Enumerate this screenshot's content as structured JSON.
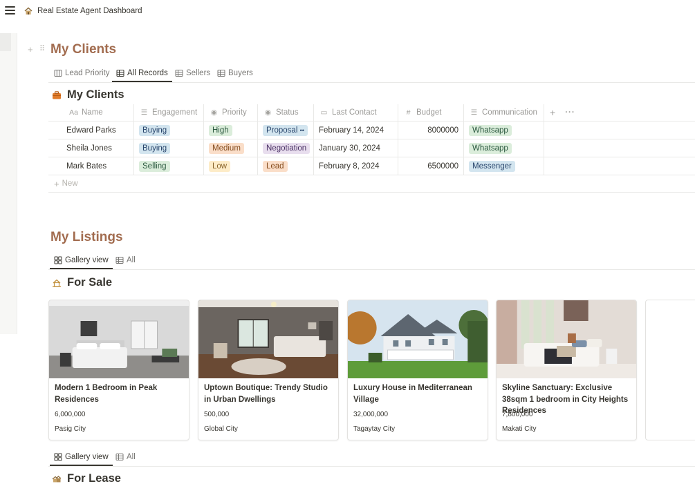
{
  "topbar": {
    "title": "Real Estate Agent Dashboard",
    "icon": "house-icon"
  },
  "clients": {
    "heading": "My Clients",
    "tabs": [
      "Lead Priority",
      "All Records",
      "Sellers",
      "Buyers"
    ],
    "active_tab": "All Records",
    "db_title": "My Clients",
    "columns": {
      "name": {
        "icon": "Aa",
        "label": "Name"
      },
      "engagement": {
        "icon": "list-icon",
        "label": "Engagement"
      },
      "priority": {
        "icon": "status-icon",
        "label": "Priority"
      },
      "status": {
        "icon": "status-icon",
        "label": "Status"
      },
      "last_contact": {
        "icon": "calendar-icon",
        "label": "Last Contact"
      },
      "budget": {
        "icon": "#",
        "label": "Budget"
      },
      "communication": {
        "icon": "list-icon",
        "label": "Communication"
      }
    },
    "add_column": "+",
    "more": "···",
    "rows": [
      {
        "name": "Edward Parks",
        "engagement": "Buying",
        "priority": "High",
        "status": "Proposal",
        "last_contact": "February 14, 2024",
        "budget": "8000000",
        "communication": "Whatsapp"
      },
      {
        "name": "Sheila Jones",
        "engagement": "Buying",
        "priority": "Medium",
        "status": "Negotiation",
        "last_contact": "January 30, 2024",
        "budget": "",
        "communication": "Whatsapp"
      },
      {
        "name": "Mark Bates",
        "engagement": "Selling",
        "priority": "Low",
        "status": "Lead",
        "last_contact": "February 8, 2024",
        "budget": "6500000",
        "communication": "Messenger"
      }
    ],
    "new_label": "New"
  },
  "listings": {
    "heading": "My Listings",
    "tabs": [
      "Gallery view",
      "All"
    ],
    "for_sale_title": "For Sale",
    "for_lease_title": "For Lease",
    "cards": [
      {
        "title": "Modern 1 Bedroom in Peak Residences",
        "price": "6,000,000",
        "city": "Pasig City"
      },
      {
        "title": "Uptown Boutique: Trendy Studio in Urban Dwellings",
        "price": "500,000",
        "city": "Global City"
      },
      {
        "title": "Luxury House in Mediterranean Village",
        "price": "32,000,000",
        "city": "Tagaytay City"
      },
      {
        "title": "Skyline Sanctuary: Exclusive 38sqm 1 bedroom in City Heights Residences",
        "price": "7,800,000",
        "city": "Makati City"
      }
    ]
  },
  "colors": {
    "heading": "#a26c4f",
    "tag_blue_bg": "#d3e5ef",
    "tag_blue_fg": "#28456c",
    "tag_green_bg": "#dbeddb",
    "tag_green_fg": "#2b593f",
    "tag_orange_bg": "#fadec9",
    "tag_orange_fg": "#854c1d",
    "tag_yellow_bg": "#fdecc8",
    "tag_yellow_fg": "#89632a",
    "tag_purple_bg": "#e8deee",
    "tag_purple_fg": "#492f64"
  }
}
